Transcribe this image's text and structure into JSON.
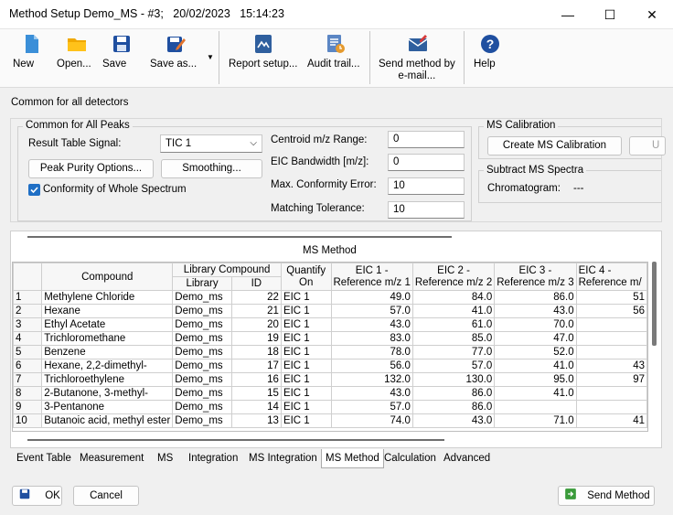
{
  "window": {
    "title": "Method Setup Demo_MS - #3;   20/02/2023   15:14:23",
    "minimize": "—",
    "maximize": "☐",
    "close": "✕"
  },
  "toolbar": {
    "new": "New",
    "open": "Open...",
    "save": "Save",
    "save_as": "Save as...",
    "report_setup": "Report setup...",
    "audit_trail": "Audit trail...",
    "send_email_line1": "Send method by",
    "send_email_line2": "e-mail...",
    "help": "Help"
  },
  "section_title": "Common for all detectors",
  "peaks": {
    "group_title": "Common for All Peaks",
    "result_signal_label": "Result Table Signal:",
    "result_signal_value": "TIC 1",
    "peak_purity_button": "Peak Purity Options...",
    "smoothing_button": "Smoothing...",
    "conformity_label": "Conformity of Whole Spectrum",
    "conformity_checked": true,
    "centroid_label": "Centroid m/z Range:",
    "centroid_value": "0",
    "eic_bandwidth_label": "EIC Bandwidth [m/z]:",
    "eic_bandwidth_value": "0",
    "max_conformity_label": "Max. Conformity Error:",
    "max_conformity_value": "10",
    "matching_tolerance_label": "Matching Tolerance:",
    "matching_tolerance_value": "10"
  },
  "ms_calibration": {
    "group_title": "MS Calibration",
    "create_button": "Create MS Calibration",
    "cut_button": "U"
  },
  "subtract": {
    "group_title": "Subtract MS Spectra",
    "chromatogram_label": "Chromatogram:",
    "chromatogram_value": "---"
  },
  "ms_method": {
    "title": "MS Method",
    "headers": {
      "compound": "Compound",
      "library_compound": "Library Compound",
      "library": "Library",
      "id": "ID",
      "quantify_on_1": "Quantify",
      "quantify_on_2": "On",
      "eic1_1": "EIC 1 -",
      "eic1_2": "Reference m/z 1",
      "eic2_1": "EIC 2 -",
      "eic2_2": "Reference m/z 2",
      "eic3_1": "EIC 3 -",
      "eic3_2": "Reference m/z 3",
      "eic4_1": "EIC 4 -",
      "eic4_2": "Reference m/"
    },
    "rows": [
      {
        "n": "1",
        "compound": "Methylene Chloride",
        "library": "Demo_ms",
        "id": "22",
        "quant": "EIC 1",
        "e1": "49.0",
        "e2": "84.0",
        "e3": "86.0",
        "e4": "51"
      },
      {
        "n": "2",
        "compound": "Hexane",
        "library": "Demo_ms",
        "id": "21",
        "quant": "EIC 1",
        "e1": "57.0",
        "e2": "41.0",
        "e3": "43.0",
        "e4": "56"
      },
      {
        "n": "3",
        "compound": "Ethyl Acetate",
        "library": "Demo_ms",
        "id": "20",
        "quant": "EIC 1",
        "e1": "43.0",
        "e2": "61.0",
        "e3": "70.0",
        "e4": ""
      },
      {
        "n": "4",
        "compound": "Trichloromethane",
        "library": "Demo_ms",
        "id": "19",
        "quant": "EIC 1",
        "e1": "83.0",
        "e2": "85.0",
        "e3": "47.0",
        "e4": ""
      },
      {
        "n": "5",
        "compound": "Benzene",
        "library": "Demo_ms",
        "id": "18",
        "quant": "EIC 1",
        "e1": "78.0",
        "e2": "77.0",
        "e3": "52.0",
        "e4": ""
      },
      {
        "n": "6",
        "compound": "Hexane, 2,2-dimethyl-",
        "library": "Demo_ms",
        "id": "17",
        "quant": "EIC 1",
        "e1": "56.0",
        "e2": "57.0",
        "e3": "41.0",
        "e4": "43"
      },
      {
        "n": "7",
        "compound": "Trichloroethylene",
        "library": "Demo_ms",
        "id": "16",
        "quant": "EIC 1",
        "e1": "132.0",
        "e2": "130.0",
        "e3": "95.0",
        "e4": "97"
      },
      {
        "n": "8",
        "compound": "2-Butanone, 3-methyl-",
        "library": "Demo_ms",
        "id": "15",
        "quant": "EIC 1",
        "e1": "43.0",
        "e2": "86.0",
        "e3": "41.0",
        "e4": ""
      },
      {
        "n": "9",
        "compound": "3-Pentanone",
        "library": "Demo_ms",
        "id": "14",
        "quant": "EIC 1",
        "e1": "57.0",
        "e2": "86.0",
        "e3": "",
        "e4": ""
      },
      {
        "n": "10",
        "compound": "Butanoic acid, methyl ester",
        "library": "Demo_ms",
        "id": "13",
        "quant": "EIC 1",
        "e1": "74.0",
        "e2": "43.0",
        "e3": "71.0",
        "e4": "41"
      }
    ]
  },
  "tabs": [
    {
      "label": "Event Table",
      "active": false
    },
    {
      "label": "Measurement",
      "active": false
    },
    {
      "label": "MS",
      "active": false
    },
    {
      "label": "Integration",
      "active": false
    },
    {
      "label": "MS Integration",
      "active": false
    },
    {
      "label": "MS Method",
      "active": true
    },
    {
      "label": "Calculation",
      "active": false
    },
    {
      "label": "Advanced",
      "active": false
    }
  ],
  "footer": {
    "ok": "OK",
    "cancel": "Cancel",
    "send_method": "Send Method"
  }
}
